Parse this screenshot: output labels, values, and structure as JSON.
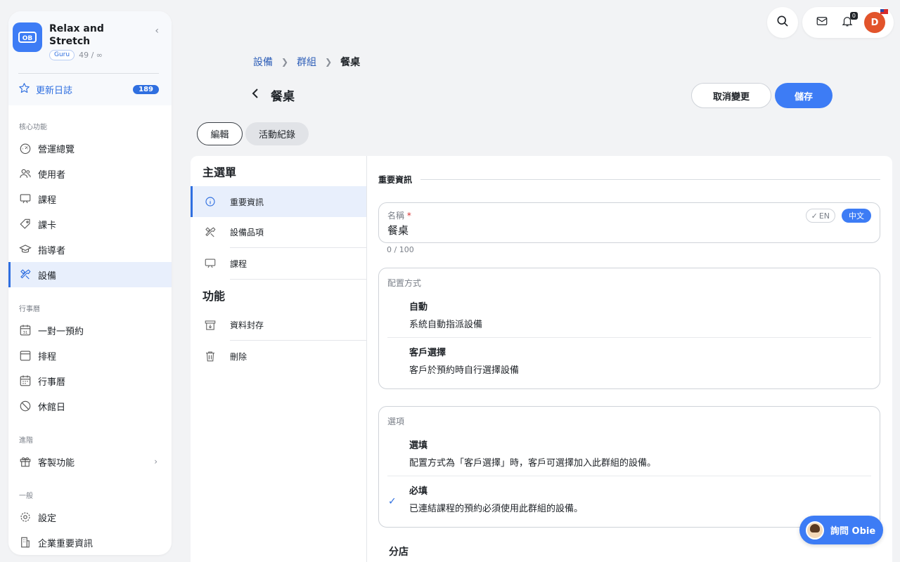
{
  "brand": {
    "name": "Relax and Stretch",
    "tier": "Guru",
    "count": "49 / ∞"
  },
  "changelog": {
    "label": "更新日誌",
    "count": "189"
  },
  "sidebar": {
    "sections": [
      {
        "title": "核心功能",
        "items": [
          "營運總覽",
          "使用者",
          "課程",
          "課卡",
          "指導者",
          "設備"
        ]
      },
      {
        "title": "行事曆",
        "items": [
          "一對一預約",
          "排程",
          "行事曆",
          "休館日"
        ]
      },
      {
        "title": "進階",
        "items": [
          "客製功能"
        ]
      },
      {
        "title": "一般",
        "items": [
          "設定",
          "企業重要資訊"
        ]
      }
    ],
    "active": "設備"
  },
  "toolbar": {
    "notifications": "0",
    "avatar_letter": "D"
  },
  "breadcrumb": {
    "items": [
      "設備",
      "群組"
    ],
    "current": "餐桌"
  },
  "page": {
    "title": "餐桌",
    "cancel_label": "取消變更",
    "save_label": "儲存"
  },
  "tabs": {
    "edit": "編輯",
    "activity": "活動紀錄"
  },
  "leftnav": {
    "main_title": "主選單",
    "main_items": [
      "重要資訊",
      "設備品項",
      "課程"
    ],
    "func_title": "功能",
    "func_items": [
      "資料封存",
      "刪除"
    ]
  },
  "form": {
    "section_title": "重要資訊",
    "name_label": "名稱",
    "name_required": "*",
    "name_value": "餐桌",
    "lang_en": "EN",
    "lang_zh": "中文",
    "counter": "0 / 100",
    "allocation": {
      "label": "配置方式",
      "options": [
        {
          "title": "自動",
          "desc": "系統自動指派設備"
        },
        {
          "title": "客戶選擇",
          "desc": "客戶於預約時自行選擇設備"
        }
      ]
    },
    "options_box": {
      "label": "選項",
      "options": [
        {
          "title": "選填",
          "desc": "配置方式為「客戶選擇」時，客戶可選擇加入此群組的設備。"
        },
        {
          "title": "必填",
          "desc": "已連結課程的預約必須使用此群組的設備。",
          "checked": true
        }
      ]
    },
    "branch_title": "分店"
  },
  "assistant": {
    "label": "詢問 Obie"
  },
  "colors": {
    "accent": "#3d7cf5",
    "active_bg": "#e8effc"
  }
}
